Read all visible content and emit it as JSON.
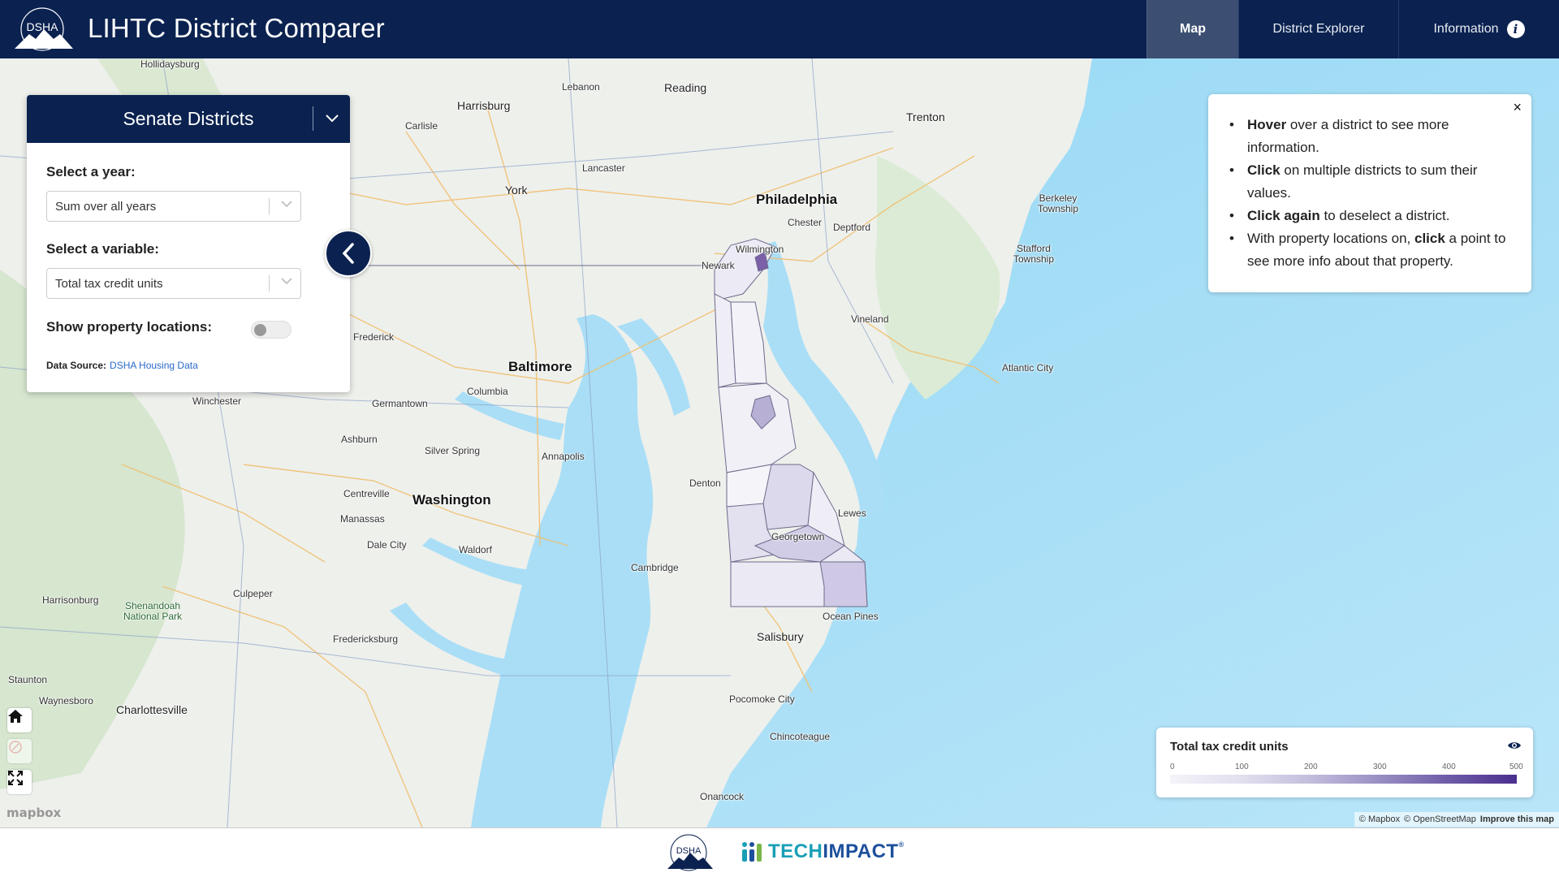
{
  "header": {
    "logo_text": "DSHA",
    "title": "LIHTC District Comparer",
    "nav": [
      {
        "label": "Map",
        "active": true
      },
      {
        "label": "District Explorer",
        "active": false
      },
      {
        "label": "Information",
        "active": false,
        "icon": "info-icon"
      }
    ]
  },
  "panel": {
    "title": "Senate Districts",
    "year_label": "Select a year:",
    "year_value": "Sum over all years",
    "variable_label": "Select a variable:",
    "variable_value": "Total tax credit units",
    "locations_label": "Show property locations:",
    "locations_on": false,
    "source_label": "Data Source:",
    "source_link": "DSHA Housing Data"
  },
  "info": {
    "items": [
      {
        "bold": "Hover",
        "text": " over a district to see more information."
      },
      {
        "bold": "Click",
        "text": " on multiple districts to sum their values."
      },
      {
        "bold": "Click again",
        "text": " to deselect a district."
      },
      {
        "pre": "With property locations on, ",
        "bold": "click",
        "text": " a point to see more info about that property."
      }
    ],
    "close": "×"
  },
  "legend": {
    "title": "Total tax credit units",
    "ticks": [
      "0",
      "100",
      "200",
      "300",
      "400",
      "500"
    ],
    "colors": [
      "#f4f3f9",
      "#4a2f8e"
    ]
  },
  "map": {
    "places": [
      {
        "name": "Hollidaysburg",
        "cls": ""
      },
      {
        "name": "Lebanon",
        "cls": ""
      },
      {
        "name": "Reading",
        "cls": "mid"
      },
      {
        "name": "Harrisburg",
        "cls": "mid"
      },
      {
        "name": "Carlisle",
        "cls": ""
      },
      {
        "name": "Trenton",
        "cls": "mid"
      },
      {
        "name": "Lancaster",
        "cls": ""
      },
      {
        "name": "York",
        "cls": "mid"
      },
      {
        "name": "Philadelphia",
        "cls": "big"
      },
      {
        "name": "Chester",
        "cls": ""
      },
      {
        "name": "Deptford",
        "cls": ""
      },
      {
        "name": "Berkeley Township",
        "cls": ""
      },
      {
        "name": "Stafford Township",
        "cls": ""
      },
      {
        "name": "Wilmington",
        "cls": ""
      },
      {
        "name": "Newark",
        "cls": ""
      },
      {
        "name": "Vineland",
        "cls": ""
      },
      {
        "name": "Frederick",
        "cls": ""
      },
      {
        "name": "Baltimore",
        "cls": "big"
      },
      {
        "name": "Atlantic City",
        "cls": ""
      },
      {
        "name": "Columbia",
        "cls": ""
      },
      {
        "name": "Germantown",
        "cls": ""
      },
      {
        "name": "Winchester",
        "cls": ""
      },
      {
        "name": "Ashburn",
        "cls": ""
      },
      {
        "name": "Silver Spring",
        "cls": ""
      },
      {
        "name": "Annapolis",
        "cls": ""
      },
      {
        "name": "Centreville",
        "cls": ""
      },
      {
        "name": "Washington",
        "cls": "big"
      },
      {
        "name": "Denton",
        "cls": ""
      },
      {
        "name": "Lewes",
        "cls": ""
      },
      {
        "name": "Georgetown",
        "cls": ""
      },
      {
        "name": "Manassas",
        "cls": ""
      },
      {
        "name": "Dale City",
        "cls": ""
      },
      {
        "name": "Waldorf",
        "cls": ""
      },
      {
        "name": "Cambridge",
        "cls": ""
      },
      {
        "name": "Harrisonburg",
        "cls": ""
      },
      {
        "name": "Culpeper",
        "cls": ""
      },
      {
        "name": "Shenandoah National Park",
        "cls": ""
      },
      {
        "name": "Ocean Pines",
        "cls": ""
      },
      {
        "name": "Fredericksburg",
        "cls": ""
      },
      {
        "name": "Salisbury",
        "cls": "mid"
      },
      {
        "name": "Staunton",
        "cls": ""
      },
      {
        "name": "Waynesboro",
        "cls": ""
      },
      {
        "name": "Charlottesville",
        "cls": ""
      },
      {
        "name": "Pocomoke City",
        "cls": ""
      },
      {
        "name": "Chincoteague",
        "cls": ""
      },
      {
        "name": "Onancock",
        "cls": ""
      }
    ],
    "mapbox_logo": "mapbox",
    "attribution": [
      "© Mapbox",
      "© OpenStreetMap",
      "Improve this map"
    ]
  },
  "footer": {
    "logo_text": "DSHA",
    "partner_part1": "TECH",
    "partner_part2": "IMPACT"
  }
}
